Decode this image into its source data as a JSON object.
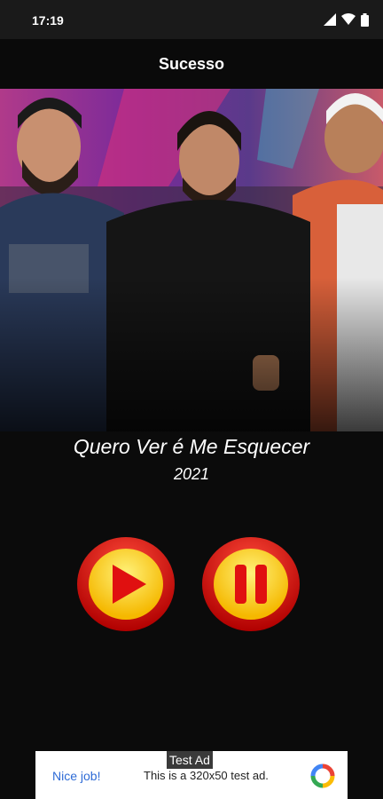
{
  "status_bar": {
    "time": "17:19"
  },
  "app_bar": {
    "title": "Sucesso"
  },
  "song": {
    "title": "Quero Ver é Me Esquecer",
    "year": "2021"
  },
  "controls": {
    "play_icon": "play-icon",
    "pause_icon": "pause-icon"
  },
  "ad": {
    "label": "Test Ad",
    "nice_text": "Nice job!",
    "description": "This is a 320x50 test ad."
  },
  "colors": {
    "button_red": "#e01010",
    "button_yellow": "#ffd400",
    "background": "#0b0b0b",
    "ad_link": "#2e6bd6"
  }
}
